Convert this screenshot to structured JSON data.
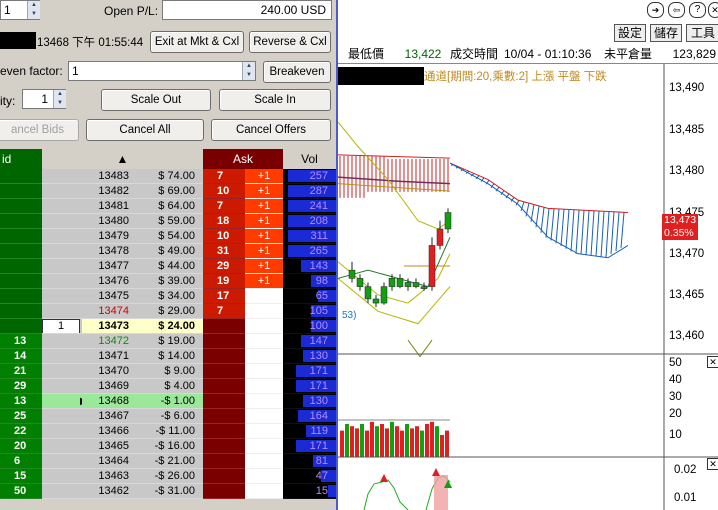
{
  "order_panel": {
    "qty_value": "1",
    "open_pl_label": "Open P/L:",
    "open_pl_value": "240.00 USD",
    "position_value": "13468 下午 01:55:44",
    "exit_button": "Exit at Mkt & Cxl",
    "reverse_button": "Reverse & Cxl",
    "breakeven_label": "even factor:",
    "breakeven_value": "1",
    "breakeven_button": "Breakeven",
    "qty_label": "ity:",
    "qty2_value": "1",
    "scale_out_button": "Scale Out",
    "scale_in_button": "Scale In",
    "cancel_bids_button": "ancel Bids",
    "cancel_all_button": "Cancel All",
    "cancel_offers_button": "Cancel Offers"
  },
  "ladder": {
    "headers": {
      "bid": "id",
      "price": "▲",
      "ask": "Ask",
      "vol": "Vol"
    },
    "rows": [
      {
        "bid": "",
        "mark": "",
        "price": "13483",
        "pl": "$ 74.00",
        "ask": "7",
        "chg": "+1",
        "vol": "257",
        "vf": 0.95
      },
      {
        "bid": "",
        "mark": "",
        "price": "13482",
        "pl": "$ 69.00",
        "ask": "10",
        "chg": "+1",
        "vol": "287",
        "vf": 0.95
      },
      {
        "bid": "",
        "mark": "",
        "price": "13481",
        "pl": "$ 64.00",
        "ask": "7",
        "chg": "+1",
        "vol": "241",
        "vf": 0.95
      },
      {
        "bid": "",
        "mark": "",
        "price": "13480",
        "pl": "$ 59.00",
        "ask": "18",
        "chg": "+1",
        "vol": "208",
        "vf": 0.95
      },
      {
        "bid": "",
        "mark": "",
        "price": "13479",
        "pl": "$ 54.00",
        "ask": "10",
        "chg": "+1",
        "vol": "311",
        "vf": 0.95
      },
      {
        "bid": "",
        "mark": "",
        "price": "13478",
        "pl": "$ 49.00",
        "ask": "31",
        "chg": "+1",
        "vol": "265",
        "vf": 0.95
      },
      {
        "bid": "",
        "mark": "",
        "price": "13477",
        "pl": "$ 44.00",
        "ask": "29",
        "chg": "+1",
        "vol": "143",
        "vf": 0.7
      },
      {
        "bid": "",
        "mark": "",
        "price": "13476",
        "pl": "$ 39.00",
        "ask": "19",
        "chg": "+1",
        "vol": "98",
        "vf": 0.5
      },
      {
        "bid": "",
        "mark": "",
        "price": "13475",
        "pl": "$ 34.00",
        "ask": "17",
        "chg": "",
        "vol": "65",
        "vf": 0.35
      },
      {
        "bid": "",
        "mark": "",
        "price": "13474",
        "pl": "$ 29.00",
        "ask": "7",
        "chg": "",
        "vol": "105",
        "vf": 0.5
      },
      {
        "bid": "",
        "mark": "1",
        "price": "13473",
        "pl": "$ 24.00",
        "ask": "",
        "chg": "",
        "vol": "100",
        "vf": 0.5,
        "current": true
      },
      {
        "bid": "13",
        "mark": "",
        "price": "13472",
        "pl": "$ 19.00",
        "ask": "",
        "chg": "",
        "vol": "147",
        "vf": 0.7
      },
      {
        "bid": "14",
        "mark": "",
        "price": "13471",
        "pl": "$ 14.00",
        "ask": "",
        "chg": "",
        "vol": "130",
        "vf": 0.65
      },
      {
        "bid": "21",
        "mark": "",
        "price": "13470",
        "pl": "$ 9.00",
        "ask": "",
        "chg": "",
        "vol": "171",
        "vf": 0.8
      },
      {
        "bid": "29",
        "mark": "",
        "price": "13469",
        "pl": "$ 4.00",
        "ask": "",
        "chg": "",
        "vol": "171",
        "vf": 0.8
      },
      {
        "bid": "13",
        "mark": "",
        "price": "13468",
        "pl": "-$ 1.00",
        "ask": "",
        "chg": "",
        "vol": "130",
        "vf": 0.65,
        "entry": true
      },
      {
        "bid": "25",
        "mark": "",
        "price": "13467",
        "pl": "-$ 6.00",
        "ask": "",
        "chg": "",
        "vol": "164",
        "vf": 0.75
      },
      {
        "bid": "22",
        "mark": "",
        "price": "13466",
        "pl": "-$ 11.00",
        "ask": "",
        "chg": "",
        "vol": "119",
        "vf": 0.6
      },
      {
        "bid": "20",
        "mark": "",
        "price": "13465",
        "pl": "-$ 16.00",
        "ask": "",
        "chg": "",
        "vol": "171",
        "vf": 0.8
      },
      {
        "bid": "6",
        "mark": "",
        "price": "13464",
        "pl": "-$ 21.00",
        "ask": "",
        "chg": "",
        "vol": "81",
        "vf": 0.45
      },
      {
        "bid": "15",
        "mark": "",
        "price": "13463",
        "pl": "-$ 26.00",
        "ask": "",
        "chg": "",
        "vol": "47",
        "vf": 0.3
      },
      {
        "bid": "50",
        "mark": "",
        "price": "13462",
        "pl": "-$ 31.00",
        "ask": "",
        "chg": "",
        "vol": "15",
        "vf": 0.15
      }
    ]
  },
  "chart": {
    "toolbar": {
      "settings": "設定",
      "save": "儲存",
      "tools": "工具"
    },
    "info": {
      "low_label": "最低價",
      "low_value": "13,422",
      "time_label": "成交時間",
      "time_value": "10/04 - 01:10:36",
      "oi_label": "未平倉量",
      "oi_value": "123,829"
    },
    "indicator_text": "通道[期間:20,乘數:2] 上漲 平盤 下跌",
    "note_text": "53)",
    "price_axis": [
      "13,490",
      "13,485",
      "13,480",
      "13,475",
      "13,470",
      "13,465",
      "13,460"
    ],
    "last_price": "13,473",
    "last_change": "0.35%",
    "volume_axis": [
      "50",
      "40",
      "30",
      "20",
      "10"
    ],
    "osc_axis": [
      "0.02",
      "0.01"
    ],
    "colors": {
      "up": "#e02020",
      "down": "#10a010",
      "cloud_red": "#d02020",
      "cloud_blue": "#1560c0"
    }
  }
}
